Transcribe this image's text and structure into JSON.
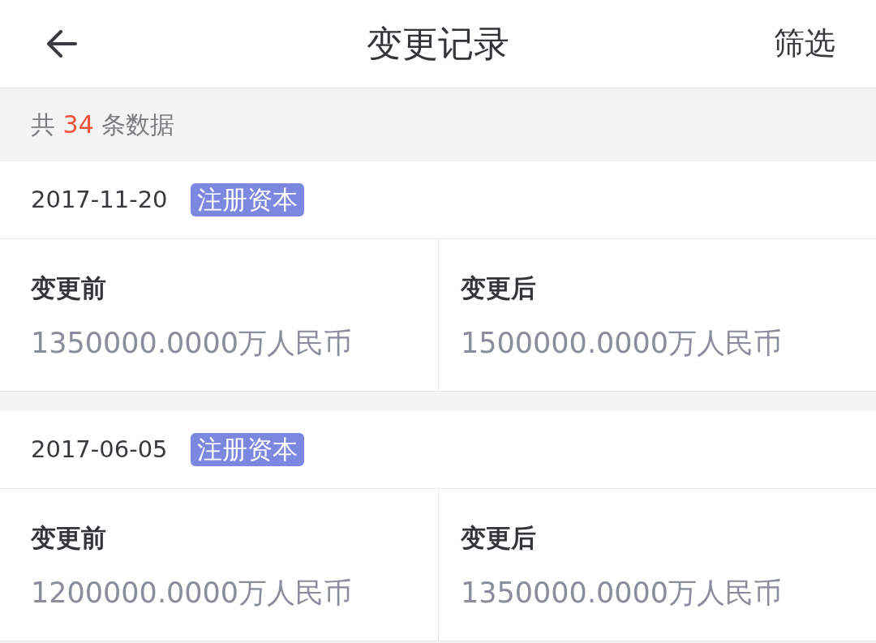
{
  "header": {
    "title": "变更记录",
    "action": "筛选"
  },
  "summary": {
    "prefix": "共",
    "count": "34",
    "suffix": "条数据"
  },
  "records": [
    {
      "date": "2017-11-20",
      "tag": "注册资本",
      "fields": [
        {
          "label": "变更前",
          "value": "1350000.0000万人民币"
        },
        {
          "label": "变更后",
          "value": "1500000.0000万人民币"
        }
      ]
    },
    {
      "date": "2017-06-05",
      "tag": "注册资本",
      "fields": [
        {
          "label": "变更前",
          "value": "1200000.0000万人民币"
        },
        {
          "label": "变更后",
          "value": "1350000.0000万人民币"
        }
      ]
    }
  ]
}
